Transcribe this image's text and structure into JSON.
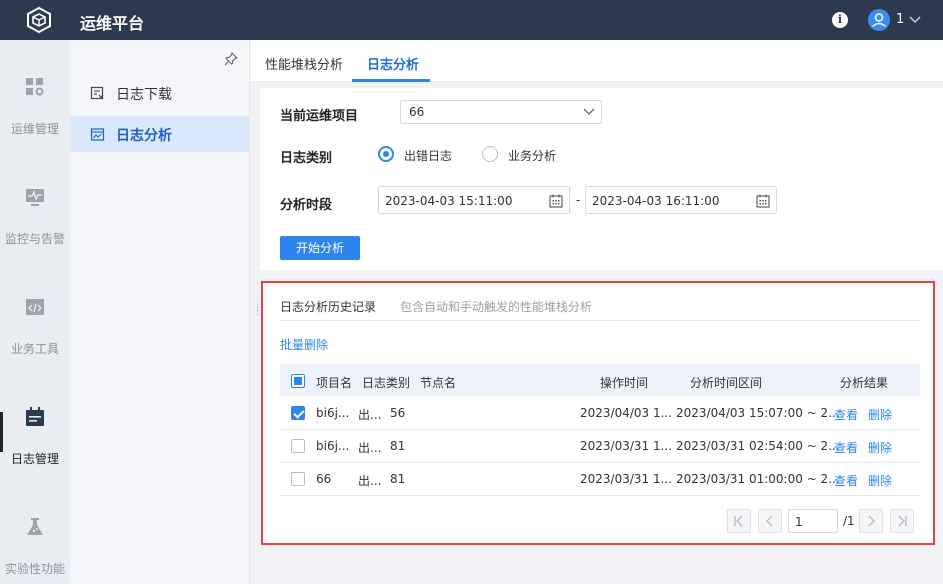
{
  "app": {
    "title": "运维平台",
    "user": "1"
  },
  "rail": [
    {
      "label": "运维管理",
      "icon": "grid-settings-icon"
    },
    {
      "label": "监控与告警",
      "icon": "monitor-pulse-icon"
    },
    {
      "label": "业务工具",
      "icon": "code-window-icon"
    },
    {
      "label": "日志管理",
      "icon": "calendar-icon",
      "active": true
    },
    {
      "label": "实验性功能",
      "icon": "flask-icon"
    }
  ],
  "subnav": [
    {
      "label": "日志下载",
      "icon": "log-download-icon"
    },
    {
      "label": "日志分析",
      "icon": "log-analysis-icon",
      "active": true
    }
  ],
  "tabs": [
    {
      "label": "性能堆栈分析"
    },
    {
      "label": "日志分析",
      "active": true
    }
  ],
  "form": {
    "project_label": "当前运维项目",
    "project_value": "66",
    "type_label": "日志类别",
    "type_options": [
      "出错日志",
      "业务分析"
    ],
    "type_selected": "出错日志",
    "period_label": "分析时段",
    "start": "2023-04-03 15:11:00",
    "end": "2023-04-03 16:11:00",
    "range_sep": "-",
    "start_btn": "开始分析"
  },
  "history": {
    "title": "日志分析历史记录",
    "subtitle": "包含自动和手动触发的性能堆栈分析",
    "batch_delete": "批量删除",
    "columns": [
      "项目名",
      "日志类别",
      "节点名",
      "操作时间",
      "分析时间区间",
      "分析结果"
    ],
    "rows": [
      {
        "project": "bi6j...",
        "type": "出...",
        "node": "56",
        "op_time": "2023/04/03 1...",
        "range": "2023/04/03 15:07:00 ~ 2...",
        "view": "查看",
        "del": "删除",
        "checked": true
      },
      {
        "project": "bi6j...",
        "type": "出...",
        "node": "81",
        "op_time": "2023/03/31 1...",
        "range": "2023/03/31 02:54:00 ~ 2...",
        "view": "查看",
        "del": "删除",
        "checked": false
      },
      {
        "project": "66",
        "type": "出...",
        "node": "81",
        "op_time": "2023/03/31 1...",
        "range": "2023/03/31 01:00:00 ~ 2...",
        "view": "查看",
        "del": "删除",
        "checked": false
      }
    ],
    "pagination": {
      "page": "1",
      "total": "/1"
    }
  },
  "colors": {
    "primary": "#2d86ee",
    "topbar": "#2c3a4f",
    "highlight_border": "#e34545"
  }
}
